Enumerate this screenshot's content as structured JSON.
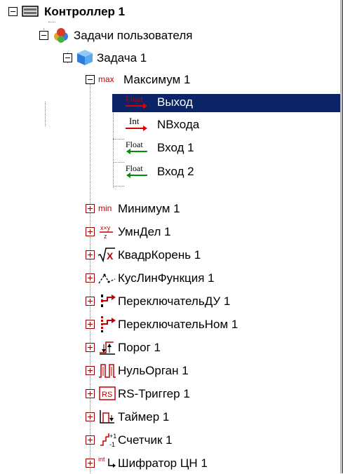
{
  "tree": {
    "controller": {
      "label": "Контроллер 1",
      "icon": "controller-icon",
      "expanded": true
    },
    "user_tasks": {
      "label": "Задачи пользователя",
      "icon": "user-tasks-icon",
      "expanded": true
    },
    "task": {
      "label": "Задача 1",
      "icon": "task-cube-icon",
      "expanded": true
    },
    "max_block": {
      "label": "Максимум 1",
      "icon": "max-icon",
      "icon_text": "max",
      "expanded": true,
      "ports": [
        {
          "label": "Выход",
          "type": "Float",
          "direction": "output",
          "selected": true
        },
        {
          "label": "NВхода",
          "type": "Int",
          "direction": "output"
        },
        {
          "label": "Вход 1",
          "type": "Float",
          "direction": "input"
        },
        {
          "label": "Вход 2",
          "type": "Float",
          "direction": "input"
        }
      ]
    },
    "blocks": [
      {
        "label": "Минимум 1",
        "icon": "min-icon",
        "icon_text": "min"
      },
      {
        "label": "УмнДел 1",
        "icon": "multiply-divide-icon",
        "icon_text": "x×y / z"
      },
      {
        "label": "КвадрКорень 1",
        "icon": "square-root-icon",
        "icon_text": "√X"
      },
      {
        "label": "КусЛинФункция 1",
        "icon": "piecewise-linear-icon"
      },
      {
        "label": "ПереключательДУ 1",
        "icon": "switch-du-icon"
      },
      {
        "label": "ПереключательНом 1",
        "icon": "switch-nom-icon"
      },
      {
        "label": "Порог 1",
        "icon": "threshold-icon"
      },
      {
        "label": "НульОрган 1",
        "icon": "null-organ-icon"
      },
      {
        "label": "RS-Триггер 1",
        "icon": "rs-trigger-icon",
        "icon_text": "RS"
      },
      {
        "label": "Таймер 1",
        "icon": "timer-icon"
      },
      {
        "label": "Счетчик 1",
        "icon": "counter-icon"
      },
      {
        "label": "Шифратор ЦН 1",
        "icon": "encoder-icon",
        "icon_text": "int"
      }
    ]
  },
  "colors": {
    "selection": "#0b2468",
    "output_arrow": "#e00000",
    "input_arrow": "#009000",
    "block_icon_red": "#c00000"
  }
}
